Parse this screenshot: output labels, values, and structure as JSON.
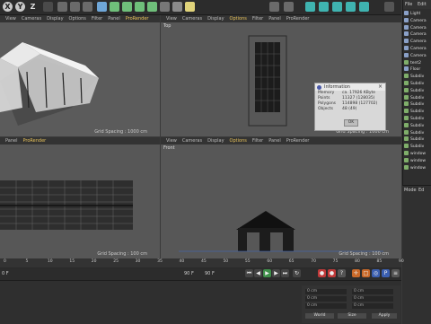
{
  "toolbar": {
    "axes": {
      "x": "X",
      "y": "Y",
      "z": "Z"
    }
  },
  "viewports": {
    "perspective": {
      "menu": [
        "View",
        "Cameras",
        "Display",
        "Options",
        "Filter",
        "Panel",
        "ProRender"
      ],
      "active_item": "ProRender",
      "name": "",
      "grid_spacing": "Grid Spacing : 1000 cm"
    },
    "top": {
      "menu": [
        "View",
        "Cameras",
        "Display",
        "Options",
        "Filter",
        "Panel",
        "ProRender"
      ],
      "active_item": "Options",
      "name": "Top",
      "grid_spacing": "Grid Spacing : 1000 cm"
    },
    "right": {
      "menu": [
        "Panel",
        "ProRender"
      ],
      "active_item": "ProRender",
      "name": "",
      "grid_spacing": "Grid Spacing : 100 cm"
    },
    "front": {
      "menu": [
        "View",
        "Cameras",
        "Display",
        "Options",
        "Filter",
        "Panel",
        "ProRender"
      ],
      "active_item": "Options",
      "name": "Front",
      "grid_spacing": "Grid Spacing : 100 cm"
    }
  },
  "info_dialog": {
    "title": "Information",
    "rows": [
      {
        "key": "Memory",
        "value": "ca. 17926 KByte"
      },
      {
        "key": "Points",
        "value": "11327 (128035)"
      },
      {
        "key": "Polygons",
        "value": "114898 (127702)"
      },
      {
        "key": "Objects",
        "value": "48 (49)"
      }
    ],
    "ok_label": "OK"
  },
  "object_manager": {
    "tabs": [
      "File",
      "Edit"
    ],
    "items": [
      {
        "label": "Light",
        "color": "#8aa0c8"
      },
      {
        "label": "Camera",
        "color": "#8aa0c8"
      },
      {
        "label": "Camera",
        "color": "#8aa0c8"
      },
      {
        "label": "Camera",
        "color": "#8aa0c8"
      },
      {
        "label": "Camera",
        "color": "#8aa0c8"
      },
      {
        "label": "Camera",
        "color": "#8aa0c8"
      },
      {
        "label": "Camera",
        "color": "#8aa0c8"
      },
      {
        "label": "tent2",
        "color": "#7fae6a"
      },
      {
        "label": "Floor",
        "color": "#8aa0c8"
      },
      {
        "label": "Subdiv",
        "color": "#7fae6a"
      },
      {
        "label": "Subdiv",
        "color": "#7fae6a"
      },
      {
        "label": "Subdiv",
        "color": "#7fae6a"
      },
      {
        "label": "Subdiv",
        "color": "#7fae6a"
      },
      {
        "label": "Subdiv",
        "color": "#7fae6a"
      },
      {
        "label": "Subdiv",
        "color": "#7fae6a"
      },
      {
        "label": "Subdiv",
        "color": "#7fae6a"
      },
      {
        "label": "Subdiv",
        "color": "#7fae6a"
      },
      {
        "label": "Subdiv",
        "color": "#7fae6a"
      },
      {
        "label": "Subdiv",
        "color": "#7fae6a"
      },
      {
        "label": "Subdiv",
        "color": "#7fae6a"
      },
      {
        "label": "window",
        "color": "#7fae6a"
      },
      {
        "label": "window",
        "color": "#7fae6a"
      },
      {
        "label": "window",
        "color": "#7fae6a"
      }
    ]
  },
  "attributes": {
    "tabs": [
      "Mode",
      "Ed"
    ]
  },
  "timeline": {
    "ticks": [
      "0",
      "5",
      "10",
      "15",
      "20",
      "25",
      "30",
      "35",
      "40",
      "45",
      "50",
      "55",
      "60",
      "65",
      "70",
      "75",
      "80",
      "85",
      "90"
    ],
    "start_frame": "0 F",
    "current_frame": "90 F",
    "end_frame": "90 F"
  },
  "coordinates": {
    "fields": [
      "0 cm",
      "0 cm",
      "0 cm",
      "0 cm",
      "0 cm",
      "0 cm"
    ],
    "buttons": {
      "left": "World",
      "mid": "Size",
      "apply": "Apply"
    }
  }
}
